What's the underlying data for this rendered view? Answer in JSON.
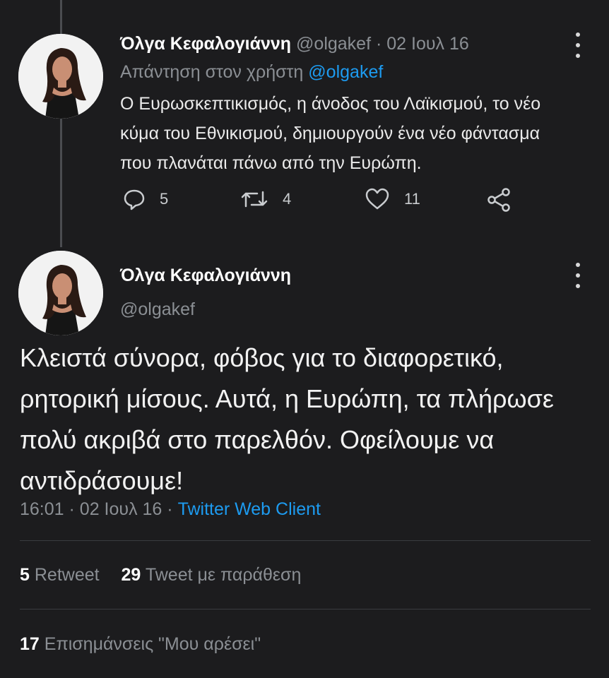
{
  "reply_tweet": {
    "author_name": "Όλγα Κεφαλογιάννη",
    "author_handle": "@olgakef",
    "separator": "·",
    "date": "02 Ιουλ 16",
    "reply_label": "Απάντηση στον χρήστη",
    "reply_to_handle": "@olgakef",
    "text": "Ο Ευρωσκεπτικισμός, η άνοδος του Λαϊκισμού, το νέο κύμα του Εθνικισμού, δημιουργούν ένα νέο φάντασμα που πλανάται πάνω από την Ευρώπη.",
    "actions": {
      "replies": "5",
      "retweets": "4",
      "likes": "11"
    }
  },
  "main_tweet": {
    "author_name": "Όλγα Κεφαλογιάννη",
    "author_handle": "@olgakef",
    "text": "Κλειστά σύνορα, φόβος για το διαφορετικό, ρητορική μίσους. Αυτά, η Ευρώπη, τα πλήρωσε πολύ ακριβά στο παρελθόν. Οφείλουμε να αντιδράσουμε!",
    "time": "16:01",
    "separator": "·",
    "date": "02 Ιουλ 16",
    "source": "Twitter Web Client"
  },
  "stats": {
    "retweets_count": "5",
    "retweets_label": "Retweet",
    "quotes_count": "29",
    "quotes_label": "Tweet με παράθεση",
    "likes_count": "17",
    "likes_label": "Επισημάνσεις \"Μου αρέσει\""
  },
  "icons": {
    "reply": "reply-icon",
    "retweet": "retweet-icon",
    "like": "heart-icon",
    "share": "share-icon",
    "more": "more-vertical-icon"
  },
  "colors": {
    "background": "#1c1c1e",
    "link": "#1d9bf0",
    "muted": "#8b8f94"
  }
}
